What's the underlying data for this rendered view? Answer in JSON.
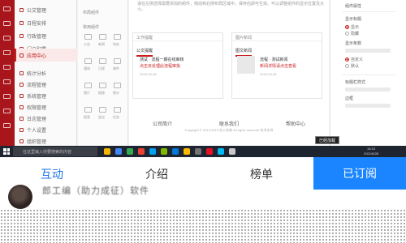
{
  "screen": {
    "sidebar": {
      "items": [
        {
          "label": "公文管理"
        },
        {
          "label": "日程安排"
        },
        {
          "label": "行政管理"
        },
        {
          "label": "门户配置"
        },
        {
          "label": "应用中心"
        },
        {
          "label": "统计分析"
        },
        {
          "label": "流程管理"
        },
        {
          "label": "系统管理"
        },
        {
          "label": "权限管理"
        },
        {
          "label": "日志管理"
        },
        {
          "label": "个人设置"
        },
        {
          "label": "组织管理"
        }
      ],
      "active_index": 4
    },
    "widget_panel": {
      "title": "布局组件",
      "section2": "常用组件",
      "labels": [
        "公告",
        "新闻",
        "待办",
        "通知",
        "日程",
        "邮件",
        "图片",
        "链接",
        "统计",
        "报表",
        "会议",
        "任务"
      ]
    },
    "canvas": {
      "notice": "请在左侧选择需要添加的组件，拖动到右侧布局区域中，保存后即可生效。可以调整组件的显示位置及大小。",
      "card_left": {
        "header": "工作提醒",
        "tab": "公文提醒",
        "line1": "测试 · 流程一期在线审核",
        "line2": "点击去处理此流程审批",
        "date": "2019-05-28"
      },
      "card_right": {
        "header": "图片新闻",
        "tab": "图文新闻",
        "line1": "流程 · 测试新闻",
        "line2": "新闻详情请点击查看",
        "date": "2019-05-28"
      },
      "links": [
        "公司简介",
        "联系我们",
        "帮助中心"
      ],
      "copyright": "Copyright © 2013-2019 办公系统 All rights reserved 技术支持"
    },
    "right_panel": {
      "title": "组件属性",
      "label1": "显示标题",
      "radios": [
        "显示",
        "隐藏",
        "自定义",
        "默认"
      ],
      "label2": "显示条数",
      "label3": "标题栏样式",
      "label4": "边框"
    },
    "taskbar": {
      "search_placeholder": "在这里输入你要搜索的内容",
      "tooltip": "已经加载",
      "time": "15:23",
      "date": "2021/5/28",
      "app_colors": [
        "#f4b400",
        "#4285f4",
        "#34a853",
        "#ea4335",
        "#00a1f1",
        "#7fba00",
        "#0078d7",
        "#ffb900",
        "#737373",
        "#e81123",
        "#00bcf2",
        "#c8c8c8"
      ]
    }
  },
  "tabs": [
    {
      "label": "互动",
      "selected": true
    },
    {
      "label": "介绍",
      "selected": false
    },
    {
      "label": "榜单",
      "selected": false
    }
  ],
  "subscribed_label": "已订阅",
  "author": {
    "text": "郎工编（助力成征）软件"
  },
  "colors": {
    "accent_blue": "#1a73e8",
    "subscribe_bg": "#1a85ff",
    "brand_red": "#a8161c"
  }
}
